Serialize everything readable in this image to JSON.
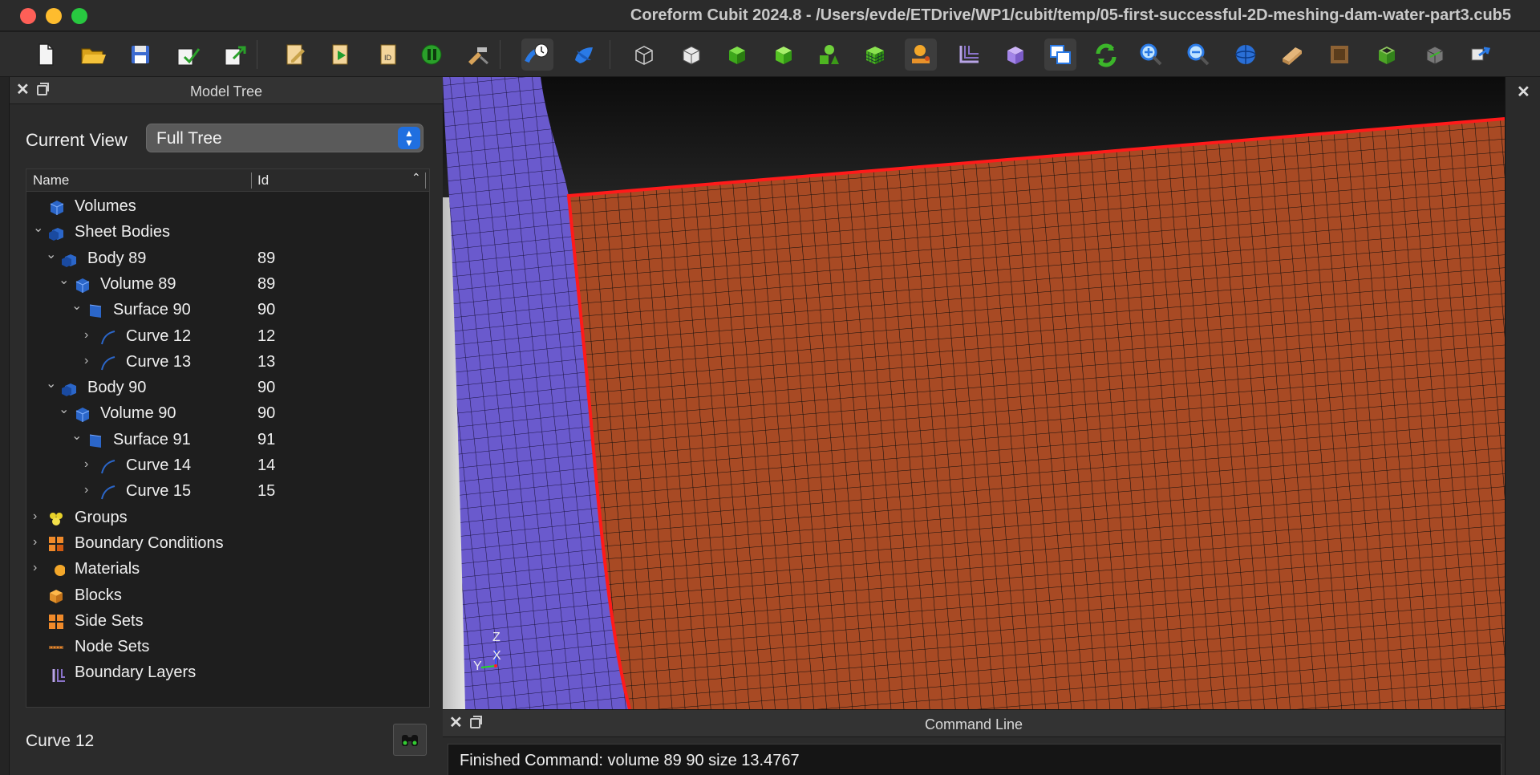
{
  "window": {
    "title": "Coreform Cubit 2024.8 - /Users/evde/ETDrive/WP1/cubit/temp/05-first-successful-2D-meshing-dam-water-part3.cub5"
  },
  "toolbar": {
    "buttons": [
      {
        "name": "new-file-icon"
      },
      {
        "name": "open-folder-icon"
      },
      {
        "name": "save-icon"
      },
      {
        "name": "import-icon"
      },
      {
        "name": "export-icon"
      },
      {
        "name": "journal-editor-icon"
      },
      {
        "name": "play-journal-icon"
      },
      {
        "name": "record-journal-icon"
      },
      {
        "name": "pause-icon"
      },
      {
        "name": "stop-recording-icon"
      },
      {
        "name": "cubit-history-icon"
      },
      {
        "name": "globe-icon"
      },
      {
        "name": "wireframe-cube-icon"
      },
      {
        "name": "hidden-line-cube-icon"
      },
      {
        "name": "shaded-cube-icon"
      },
      {
        "name": "green-cube-icon"
      },
      {
        "name": "geometry-cluster-icon"
      },
      {
        "name": "mesh-cube-icon"
      },
      {
        "name": "materials-icon"
      },
      {
        "name": "boundary-layers-icon"
      },
      {
        "name": "purple-cube-icon"
      },
      {
        "name": "windows-icon"
      },
      {
        "name": "refresh-icon"
      },
      {
        "name": "zoom-in-icon"
      },
      {
        "name": "zoom-out-icon"
      },
      {
        "name": "sphere-icon"
      },
      {
        "name": "plank-icon"
      },
      {
        "name": "wood-box-icon"
      },
      {
        "name": "transparent-cube-icon"
      },
      {
        "name": "grey-cube-icon"
      },
      {
        "name": "cube-arrow-icon"
      }
    ]
  },
  "model_tree": {
    "title": "Model Tree",
    "current_view_label": "Current View",
    "current_view_value": "Full Tree",
    "col_name": "Name",
    "col_id": "Id",
    "rows": [
      {
        "label": "Volumes",
        "id": "",
        "icon": "volume-icon",
        "chev": "",
        "indent": 0
      },
      {
        "label": "Sheet Bodies",
        "id": "",
        "icon": "body-icon",
        "chev": "⌄",
        "indent": 0
      },
      {
        "label": "Body 89",
        "id": "89",
        "icon": "body-icon",
        "chev": "⌄",
        "indent": 1
      },
      {
        "label": "Volume 89",
        "id": "89",
        "icon": "volume-icon",
        "chev": "⌄",
        "indent": 2
      },
      {
        "label": "Surface 90",
        "id": "90",
        "icon": "surface-icon",
        "chev": "⌄",
        "indent": 3
      },
      {
        "label": "Curve 12",
        "id": "12",
        "icon": "curve-icon",
        "chev": "›",
        "indent": 4
      },
      {
        "label": "Curve 13",
        "id": "13",
        "icon": "curve-icon",
        "chev": "›",
        "indent": 4
      },
      {
        "label": "Body 90",
        "id": "90",
        "icon": "body-icon",
        "chev": "⌄",
        "indent": 1
      },
      {
        "label": "Volume 90",
        "id": "90",
        "icon": "volume-icon",
        "chev": "⌄",
        "indent": 2
      },
      {
        "label": "Surface 91",
        "id": "91",
        "icon": "surface-icon",
        "chev": "⌄",
        "indent": 3
      },
      {
        "label": "Curve 14",
        "id": "14",
        "icon": "curve-icon",
        "chev": "›",
        "indent": 4
      },
      {
        "label": "Curve 15",
        "id": "15",
        "icon": "curve-icon",
        "chev": "›",
        "indent": 4
      },
      {
        "label": "Groups",
        "id": "",
        "icon": "groups-icon",
        "chev": "›",
        "indent": 0
      },
      {
        "label": "Boundary Conditions",
        "id": "",
        "icon": "boundary-conditions-icon",
        "chev": "›",
        "indent": 0
      },
      {
        "label": "Materials",
        "id": "",
        "icon": "materials-icon",
        "chev": "›",
        "indent": 0
      },
      {
        "label": "Blocks",
        "id": "",
        "icon": "blocks-icon",
        "chev": "",
        "indent": 0
      },
      {
        "label": "Side Sets",
        "id": "",
        "icon": "side-sets-icon",
        "chev": "",
        "indent": 0
      },
      {
        "label": "Node Sets",
        "id": "",
        "icon": "node-sets-icon",
        "chev": "",
        "indent": 0
      },
      {
        "label": "Boundary Layers",
        "id": "",
        "icon": "boundary-layers-icon",
        "chev": "",
        "indent": 0
      }
    ],
    "selected_label": "Curve 12"
  },
  "viewport": {
    "axis_z": "Z",
    "axis_x": "X",
    "axis_y": "Y",
    "colors": {
      "dam": "#6a5acd",
      "water": "#a84a24",
      "highlight": "#ff1a1a"
    }
  },
  "command_line": {
    "title": "Command Line",
    "output": "Finished Command: volume 89 90 size 13.4767"
  }
}
